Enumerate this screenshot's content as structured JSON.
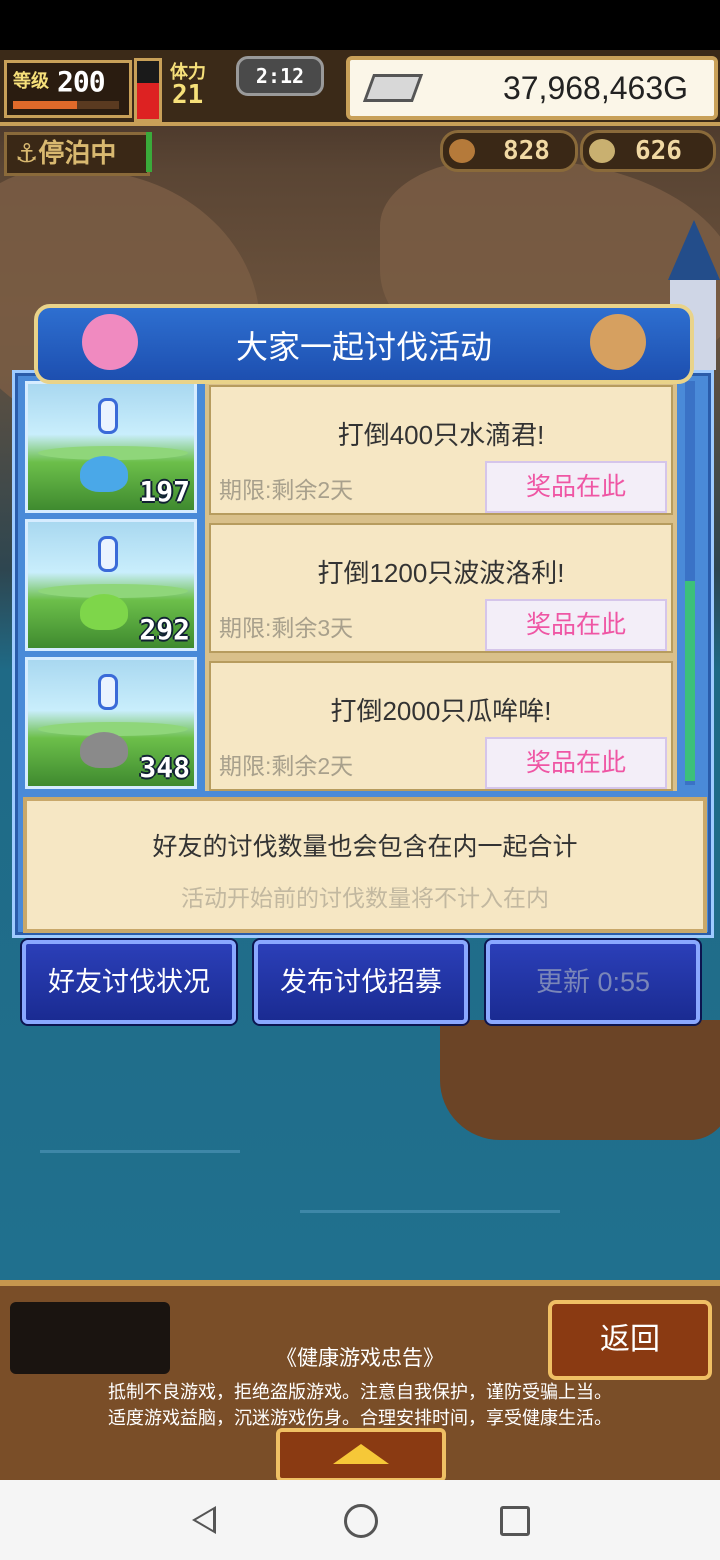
{
  "hud": {
    "level_label": "等级",
    "level": "200",
    "stamina_label": "体力",
    "stamina": "21",
    "clock": "2:12",
    "gold": "37,968,463G",
    "status": "停泊中",
    "resource_1": "828",
    "resource_2": "626"
  },
  "panel": {
    "title": "大家一起讨伐活动",
    "quests": [
      {
        "name": "打倒400只水滴君!",
        "deadline": "期限:剩余2天",
        "reward": "奖品在此",
        "count": "197",
        "monster_color": "#4aa8e8"
      },
      {
        "name": "打倒1200只波波洛利!",
        "deadline": "期限:剩余3天",
        "reward": "奖品在此",
        "count": "292",
        "monster_color": "#7ed64a"
      },
      {
        "name": "打倒2000只瓜哞哞!",
        "deadline": "期限:剩余2天",
        "reward": "奖品在此",
        "count": "348",
        "monster_color": "#8a8a8a"
      }
    ],
    "info_main": "好友的讨伐数量也会包含在内一起合计",
    "info_sub": "活动开始前的讨伐数量将不计入在内"
  },
  "actions": {
    "friends": "好友讨伐状况",
    "recruit": "发布讨伐招募",
    "refresh": "更新 0:55"
  },
  "bottom": {
    "back": "返回",
    "notice_title": "《健康游戏忠告》",
    "notice_line1": "抵制不良游戏，拒绝盗版游戏。注意自我保护，谨防受骗上当。",
    "notice_line2": "适度游戏益脑，沉迷游戏伤身。合理安排时间，享受健康生活。"
  },
  "colors": {
    "panel_blue": "#4a8ad8",
    "card_bg": "#f6e7c4",
    "reward_text": "#ef56a4",
    "button_blue": "#2b3fb8"
  }
}
